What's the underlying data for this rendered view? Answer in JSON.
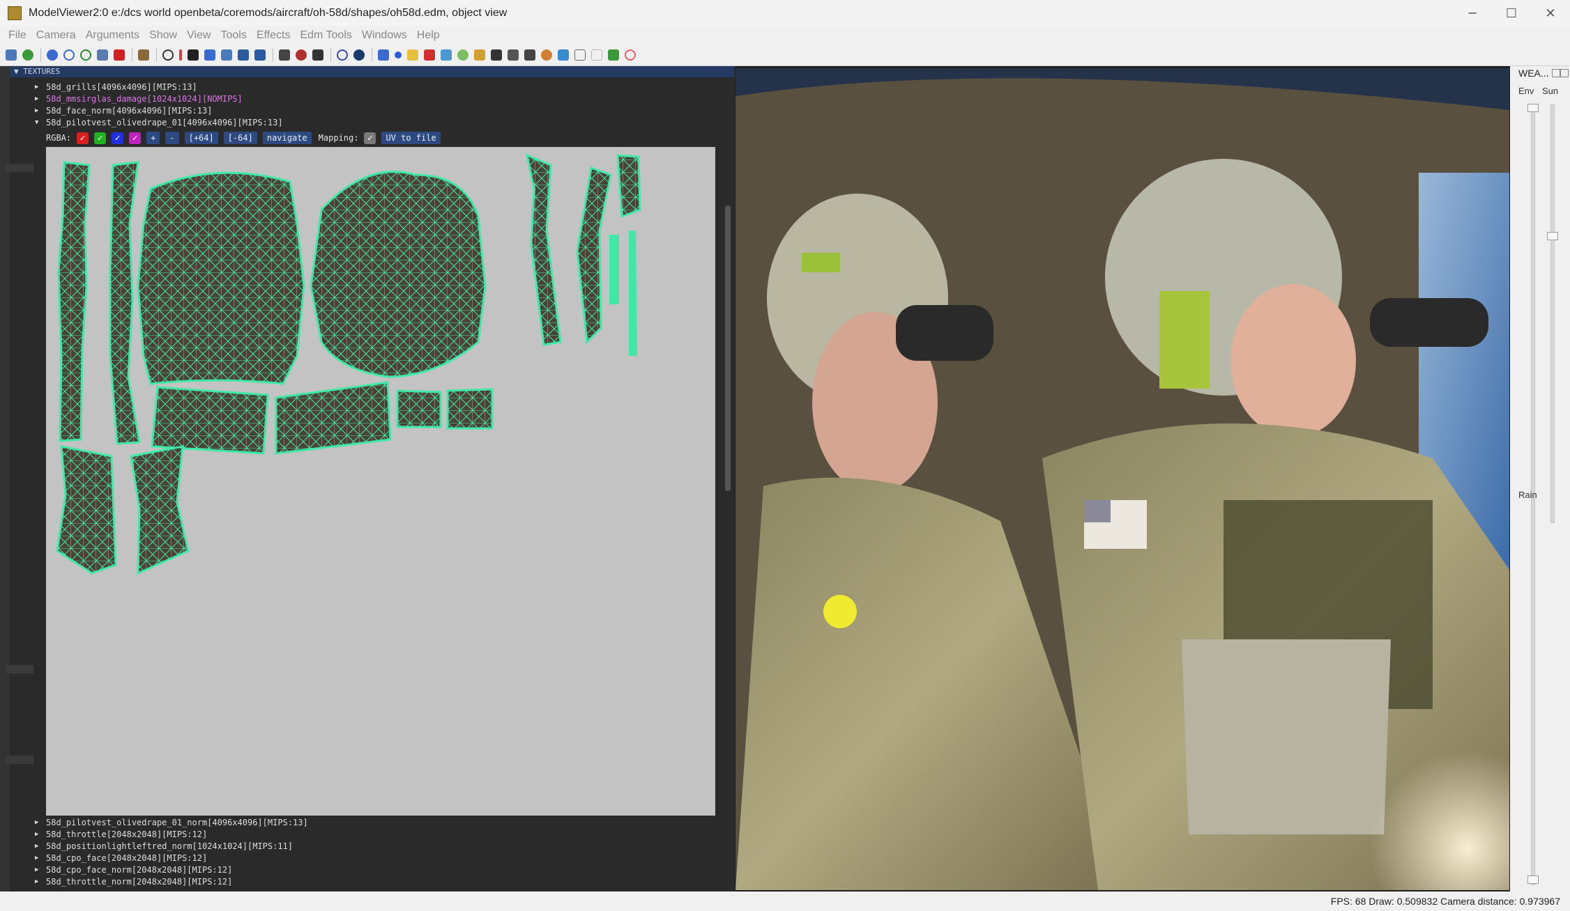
{
  "window": {
    "title": "ModelViewer2:0 e:/dcs world openbeta/coremods/aircraft/oh-58d/shapes/oh58d.edm, object view",
    "min": "─",
    "max": "☐",
    "close": "✕"
  },
  "menu": [
    "File",
    "Camera",
    "Arguments",
    "Show",
    "View",
    "Tools",
    "Effects",
    "Edm Tools",
    "Windows",
    "Help"
  ],
  "textures": {
    "header": "▼ TEXTURES",
    "items_top": [
      {
        "label": "58d_grills[4096x4096][MIPS:13]",
        "style": "normal",
        "arrow": "▶"
      },
      {
        "label": "58d_mmsirglas_damage[1024x1024][NOMIPS]",
        "style": "pink",
        "arrow": "▶"
      },
      {
        "label": "58d_face_norm[4096x4096][MIPS:13]",
        "style": "normal",
        "arrow": "▶"
      },
      {
        "label": "58d_pilotvest_olivedrape_01[4096x4096][MIPS:13]",
        "style": "normal",
        "arrow": "▼"
      }
    ],
    "rgba_label": "RGBA:",
    "checkbox_colors": [
      "#d82020",
      "#20b020",
      "#2030e0",
      "#c020c0"
    ],
    "check_mark": "✓",
    "plus": "+",
    "minus": "-",
    "plus64": "[+64]",
    "minus64": "[-64]",
    "navigate": "navigate",
    "mapping_label": "Mapping:",
    "uv_to_file": "UV to file",
    "items_bottom": [
      {
        "label": "58d_pilotvest_olivedrape_01_norm[4096x4096][MIPS:13]",
        "arrow": "▶"
      },
      {
        "label": "58d_throttle[2048x2048][MIPS:12]",
        "arrow": "▶"
      },
      {
        "label": "58d_positionlightleftred_norm[1024x1024][MIPS:11]",
        "arrow": "▶"
      },
      {
        "label": "58d_cpo_face[2048x2048][MIPS:12]",
        "arrow": "▶"
      },
      {
        "label": "58d_cpo_face_norm[2048x2048][MIPS:12]",
        "arrow": "▶"
      },
      {
        "label": "58d_throttle_norm[2048x2048][MIPS:12]",
        "arrow": "▶"
      }
    ]
  },
  "colors": {
    "uv_wire": "#40e8a8",
    "uv_fill": "#4a4235",
    "canvas_bg": "#c3c3c3",
    "header_bg": "#253a63"
  },
  "weather": {
    "title": "WEA...",
    "env": "Env",
    "sun": "Sun",
    "rain": "Rain"
  },
  "status": "FPS: 68  Draw: 0.509832  Camera distance: 0.973967"
}
